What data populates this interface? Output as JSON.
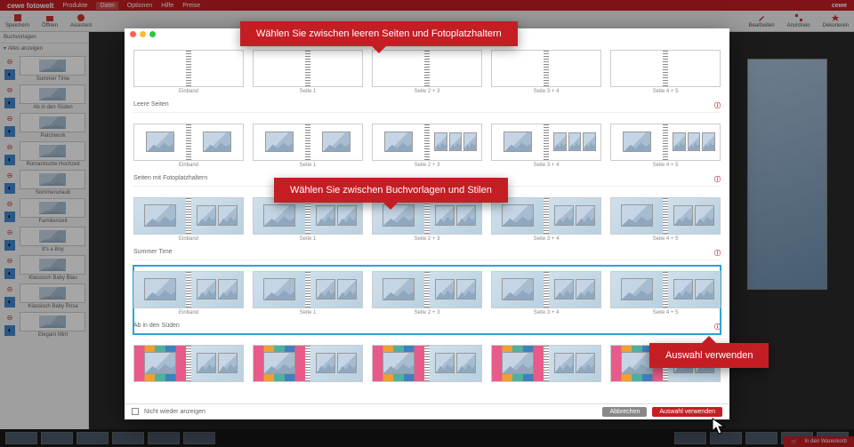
{
  "topbar": {
    "logo": "cewe fotowelt",
    "menu": [
      "Produkte",
      "Datei",
      "Optionen",
      "Hilfe",
      "Preise"
    ],
    "brand": "cewe"
  },
  "toolbar": {
    "left": [
      "Speichern",
      "Öffnen",
      "Assistent"
    ],
    "right": [
      "Bearbeiten",
      "Anordnen",
      "Dekorieren"
    ]
  },
  "sidebar": {
    "title": "Buchvorlagen",
    "toggle": "Alles anzeigen",
    "items": [
      {
        "label": "Summer Time"
      },
      {
        "label": "Ab in den Süden"
      },
      {
        "label": "Patchwork"
      },
      {
        "label": "Romantische Hochzeit"
      },
      {
        "label": "Sommerurlaub"
      },
      {
        "label": "Familienzeit"
      },
      {
        "label": "It's a Boy"
      },
      {
        "label": "Klassisch Baby Blau"
      },
      {
        "label": "Klassisch Baby Rosa"
      },
      {
        "label": "Elegant Mint"
      }
    ]
  },
  "modal": {
    "sections": [
      {
        "title": "Leere Seiten",
        "cards": [
          "Einband",
          "Seite 1",
          "Seite 2 + 3",
          "Seite 3 + 4",
          "Seite 4 + 5"
        ]
      },
      {
        "title": "Seiten mit Fotoplatzhaltern",
        "cards": [
          "Einband",
          "Seite 1",
          "Seite 2 + 3",
          "Seite 3 + 4",
          "Seite 4 + 5"
        ]
      },
      {
        "title": "Summer Time",
        "cards": [
          "Einband",
          "Seite 1",
          "Seite 2 + 3",
          "Seite 3 + 4",
          "Seite 4 + 5"
        ]
      },
      {
        "title": "Ab in den Süden",
        "cards": [
          "Einband",
          "Seite 1",
          "Seite 2 + 3",
          "Seite 3 + 4",
          "Seite 4 + 5"
        ]
      },
      {
        "title": "",
        "cards": [
          "",
          "",
          "",
          "",
          ""
        ]
      }
    ],
    "footer": {
      "checkbox_label": "Nicht wieder anzeigen",
      "cancel": "Abbrechen",
      "apply": "Auswahl verwenden"
    }
  },
  "callouts": {
    "c1": "Wählen Sie zwischen leeren Seiten und Fotoplatzhaltern",
    "c2": "Wählen Sie zwischen Buchvorlagen und Stilen",
    "c3": "Auswahl verwenden"
  },
  "bottombar": {
    "cart": "In den Warenkorb"
  }
}
